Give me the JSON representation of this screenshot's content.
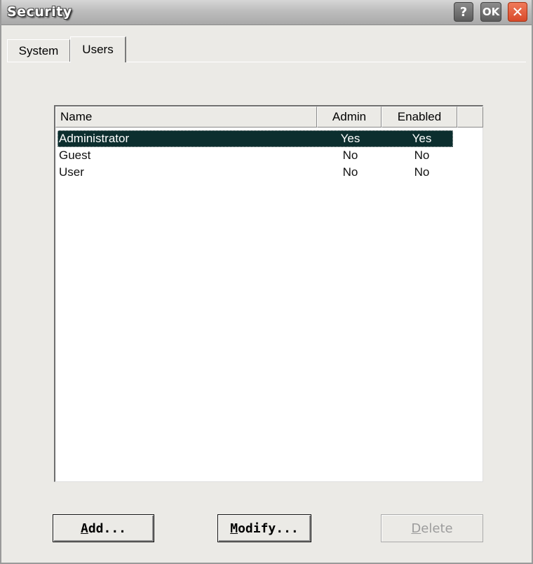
{
  "window": {
    "title": "Security",
    "help_label": "?",
    "ok_label": "OK",
    "close_label": "✕"
  },
  "tabs": [
    {
      "label": "System",
      "active": false
    },
    {
      "label": "Users",
      "active": true
    }
  ],
  "list": {
    "columns": {
      "name": "Name",
      "admin": "Admin",
      "enabled": "Enabled"
    },
    "rows": [
      {
        "name": "Administrator",
        "admin": "Yes",
        "enabled": "Yes",
        "selected": true
      },
      {
        "name": "Guest",
        "admin": "No",
        "enabled": "No",
        "selected": false
      },
      {
        "name": "User",
        "admin": "No",
        "enabled": "No",
        "selected": false
      }
    ]
  },
  "buttons": {
    "add": {
      "mnemonic": "A",
      "rest": "dd..."
    },
    "modify": {
      "mnemonic": "M",
      "rest": "odify..."
    },
    "delete": {
      "mnemonic": "D",
      "rest": "elete",
      "disabled": true
    }
  },
  "colors": {
    "selection": "#0c2e2e",
    "close_button": "#d84a2a",
    "dialog_bg": "#ebeae6"
  }
}
